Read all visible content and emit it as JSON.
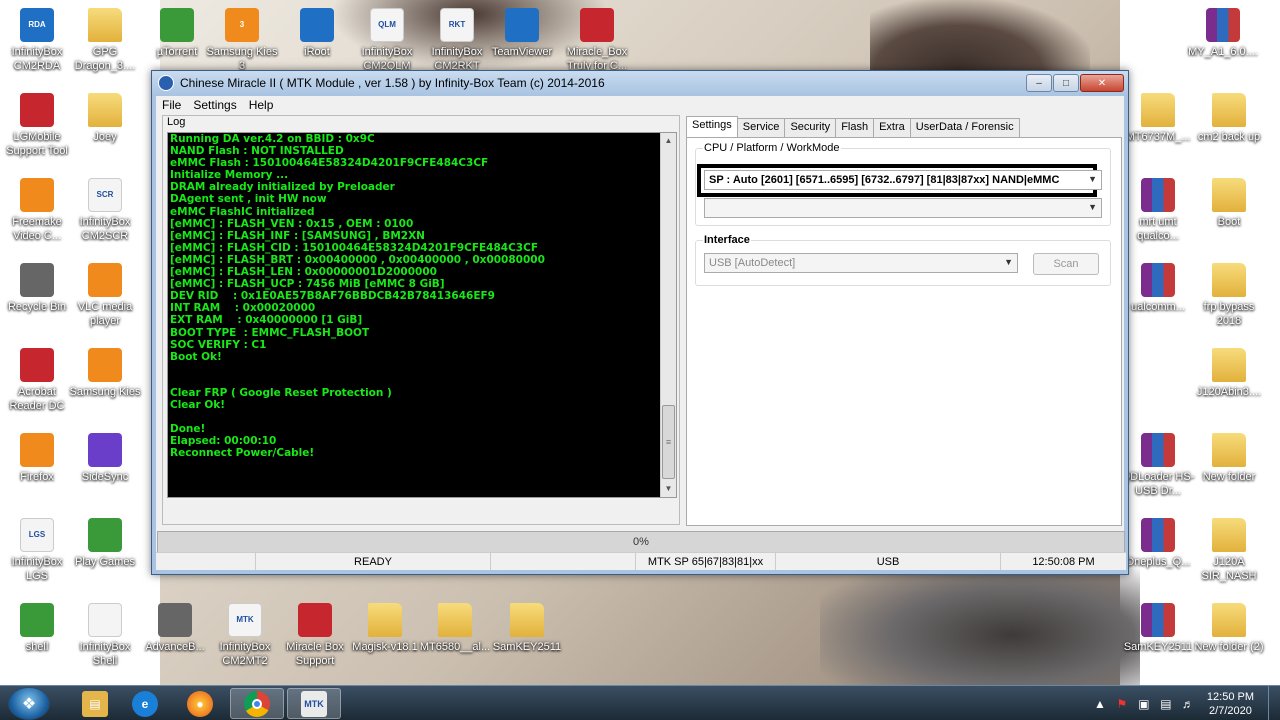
{
  "desktop_icons": [
    {
      "label": "InfinityBox CM2RDA",
      "icon": "infinitybox-rda-icon",
      "badge": "RDA"
    },
    {
      "label": "GPG Dragon_3....",
      "icon": "folder-icon"
    },
    {
      "label": "µTorrent",
      "icon": "utorrent-icon"
    },
    {
      "label": "Samsung Kies 3",
      "icon": "samsung-kies-icon",
      "badge": "3"
    },
    {
      "label": "iRoot",
      "icon": "iroot-icon"
    },
    {
      "label": "InfinityBox CM2QLM",
      "icon": "infinitybox-qlm-icon",
      "badge": "QLM"
    },
    {
      "label": "InfinityBox CM2RKT",
      "icon": "infinitybox-rkt-icon",
      "badge": "RKT"
    },
    {
      "label": "TeamViewer",
      "icon": "teamviewer-icon"
    },
    {
      "label": "Miracle_Box Truly for C...",
      "icon": "miracle-box-icon"
    },
    {
      "label": "MY_A1_6.0....",
      "icon": "winrar-icon"
    },
    {
      "label": "LGMobile Support Tool",
      "icon": "lg-mobile-icon"
    },
    {
      "label": "Joey",
      "icon": "folder-icon"
    },
    {
      "label": "MT6737M_...",
      "icon": "folder-icon"
    },
    {
      "label": "cm2 back up",
      "icon": "folder-icon"
    },
    {
      "label": "Freemake Video C...",
      "icon": "freemake-icon"
    },
    {
      "label": "InfinityBox CM2SCR",
      "icon": "infinitybox-scr-icon",
      "badge": "SCR"
    },
    {
      "label": "mrt umt qualco...",
      "icon": "winrar-icon"
    },
    {
      "label": "Boot",
      "icon": "folder-icon"
    },
    {
      "label": "Recycle Bin",
      "icon": "recycle-bin-icon"
    },
    {
      "label": "VLC media player",
      "icon": "vlc-icon"
    },
    {
      "label": "ualcomm...",
      "icon": "winrar-icon"
    },
    {
      "label": "frp bypass 2018",
      "icon": "folder-icon"
    },
    {
      "label": "Acrobat Reader DC",
      "icon": "acrobat-icon"
    },
    {
      "label": "Samsung Kies",
      "icon": "samsung-kies-icon"
    },
    {
      "label": "J120Abin3....",
      "icon": "folder-icon"
    },
    {
      "label": "Firefox",
      "icon": "firefox-icon"
    },
    {
      "label": "SideSync",
      "icon": "sidesync-icon"
    },
    {
      "label": "QDLoader HS-USB Dr...",
      "icon": "winrar-icon"
    },
    {
      "label": "New folder",
      "icon": "folder-icon"
    },
    {
      "label": "InfinityBox LGS",
      "icon": "infinitybox-lgs-icon",
      "badge": "LGS"
    },
    {
      "label": "Play Games",
      "icon": "play-games-icon"
    },
    {
      "label": "Oneplus_Q...",
      "icon": "winrar-icon"
    },
    {
      "label": "J120A SIR_NASH",
      "icon": "folder-icon"
    },
    {
      "label": "shell",
      "icon": "shell-icon"
    },
    {
      "label": "InfinityBox Shell",
      "icon": "infinitybox-shell-icon"
    },
    {
      "label": "AdvanceB...",
      "icon": "advance-box-icon"
    },
    {
      "label": "InfinityBox CM2MT2",
      "icon": "infinitybox-mtk-icon",
      "badge": "MTK"
    },
    {
      "label": "Miracle Box Support",
      "icon": "miracle-box-icon"
    },
    {
      "label": "Magisk-v18.1",
      "icon": "folder-icon"
    },
    {
      "label": "MT6580__al...",
      "icon": "folder-icon"
    },
    {
      "label": "SamKEY2511",
      "icon": "folder-icon"
    },
    {
      "label": "SamKEY2511",
      "icon": "winrar-icon"
    },
    {
      "label": "New folder (2)",
      "icon": "folder-icon"
    }
  ],
  "window": {
    "title": "Chinese Miracle II ( MTK Module , ver 1.58 ) by Infinity-Box Team (c) 2014-2016",
    "menu": [
      "File",
      "Settings",
      "Help"
    ],
    "log_label": "Log",
    "log_lines": [
      "Running DA ver.4.2 on BBID : 0x9C",
      "NAND Flash : NOT INSTALLED",
      "eMMC Flash : 150100464E58324D4201F9CFE484C3CF",
      "Initialize Memory ...",
      "DRAM already initialized by Preloader",
      "DAgent sent , init HW now",
      "eMMC FlashIC initialized",
      "[eMMC] : FLASH_VEN : 0x15 , OEM : 0100",
      "[eMMC] : FLASH_INF : [SAMSUNG] , BM2XN",
      "[eMMC] : FLASH_CID : 150100464E58324D4201F9CFE484C3CF",
      "[eMMC] : FLASH_BRT : 0x00400000 , 0x00400000 , 0x00080000",
      "[eMMC] : FLASH_LEN : 0x00000001D2000000",
      "[eMMC] : FLASH_UCP : 7456 MiB [eMMC 8 GiB]",
      "DEV RID    : 0x1E0AE57B8AF76BBDCB42B78413646EF9",
      "INT RAM    : 0x00020000",
      "EXT RAM    : 0x40000000 [1 GiB]",
      "BOOT TYPE  : EMMC_FLASH_BOOT",
      "SOC VERIFY : C1",
      "Boot Ok!",
      "",
      "",
      "Clear FRP ( Google Reset Protection )",
      "Clear Ok!",
      "",
      "Done!",
      "Elapsed: 00:00:10",
      "Reconnect Power/Cable!"
    ],
    "tabs": [
      "Settings",
      "Service",
      "Security",
      "Flash",
      "Extra",
      "UserData / Forensic"
    ],
    "cpu_group_label": "CPU / Platform / WorkMode",
    "cpu_select_value": "SP : Auto [2601] [6571..6595] [6732..6797] [81|83|87xx]  NAND|eMMC",
    "second_select_value": "",
    "interface_label": "Interface",
    "interface_value": "USB [AutoDetect]",
    "scan_label": "Scan",
    "progress_text": "0%",
    "progress_value": 0,
    "status": {
      "cell1": "",
      "state": "READY",
      "cell3": "",
      "module": "MTK SP 65|67|83|81|xx",
      "port": "USB",
      "time": "12:50:08 PM"
    }
  },
  "taskbar": {
    "items": [
      "windows-explorer-icon",
      "internet-explorer-icon",
      "firefox-icon",
      "chrome-icon",
      "mtk-infinity-icon"
    ],
    "clock_time": "12:50 PM",
    "clock_date": "2/7/2020"
  }
}
